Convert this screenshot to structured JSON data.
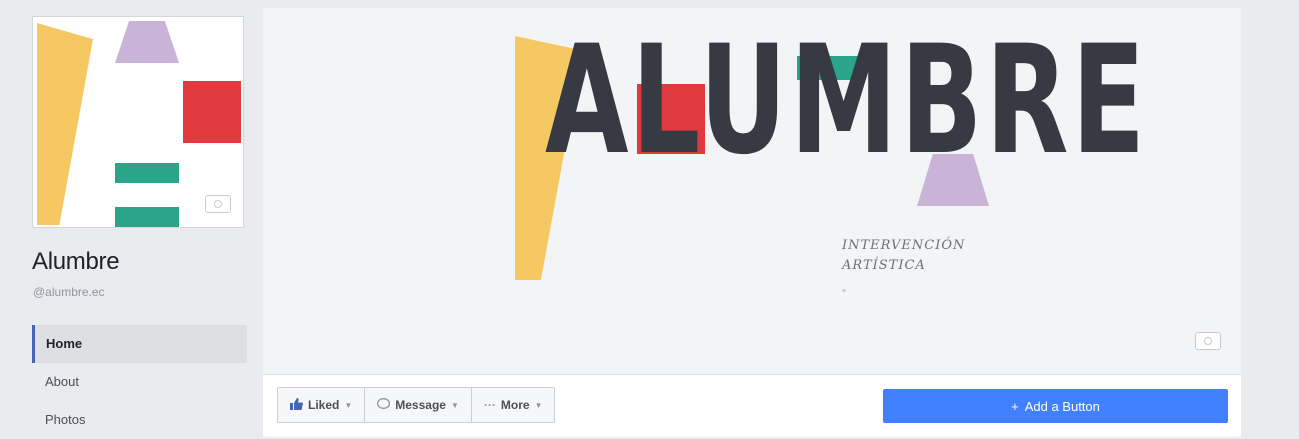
{
  "page": {
    "name": "Alumbre",
    "handle": "@alumbre.ec"
  },
  "nav": {
    "items": [
      {
        "label": "Home",
        "active": true
      },
      {
        "label": "About",
        "active": false
      },
      {
        "label": "Photos",
        "active": false
      }
    ]
  },
  "cover": {
    "logo": "ALUMBRE",
    "tagline_line1": "INTERVENCIÓN",
    "tagline_line2": "ARTÍSTICA",
    "quote": "”"
  },
  "actions": {
    "liked_label": "Liked",
    "message_label": "Message",
    "more_label": "More",
    "add_button_label": "Add a Button"
  },
  "colors": {
    "brand_blue": "#4080ff",
    "nav_accent": "#4267b2",
    "logo_yellow": "#f6c862",
    "logo_purple": "#c9b3d6",
    "logo_red": "#e03a3e",
    "logo_teal": "#2aa58a",
    "logo_dark": "#373a43"
  },
  "icons": {
    "camera": "camera-icon",
    "like": "thumbs-up-icon",
    "message": "speech-bubble-icon",
    "more": "ellipsis-icon",
    "plus": "plus-icon"
  }
}
